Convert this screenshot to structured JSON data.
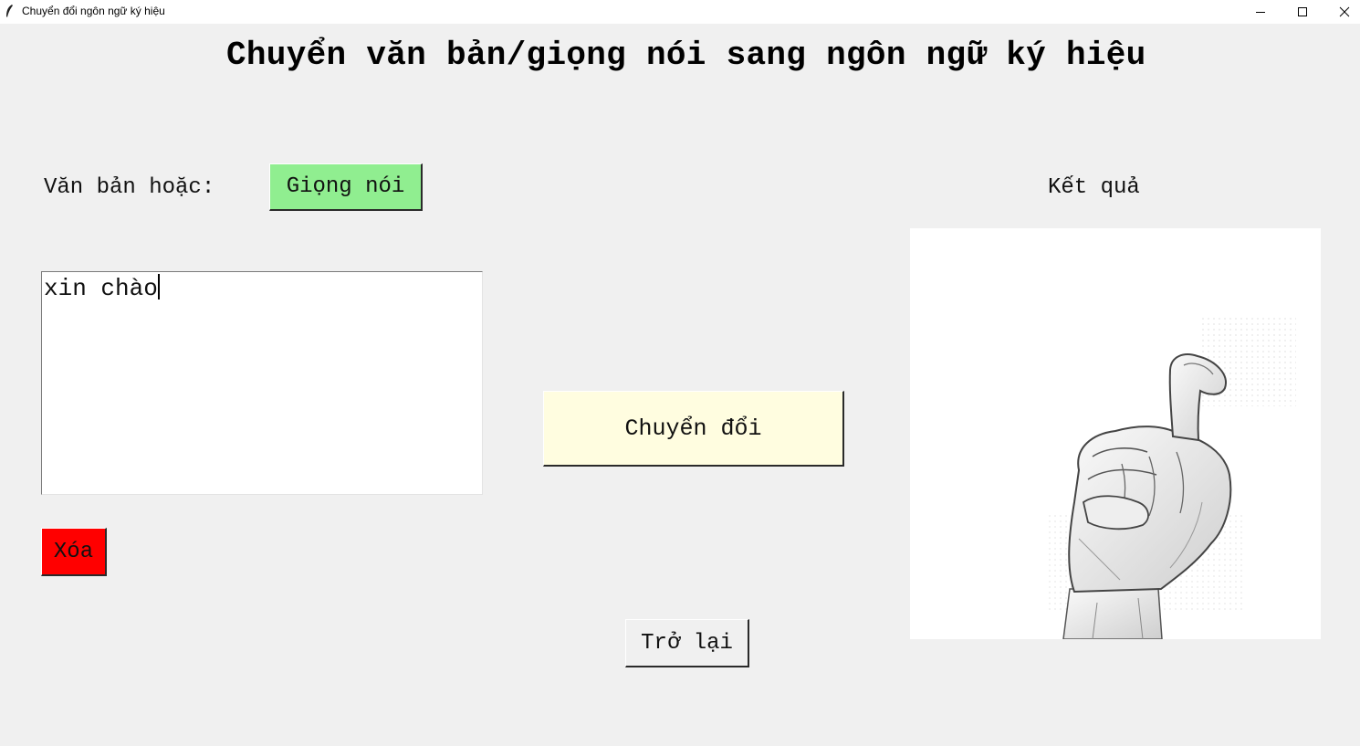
{
  "window": {
    "title": "Chuyển đổi ngôn ngữ ký hiệu",
    "icon": "feather-icon",
    "controls": [
      "minimize-icon",
      "maximize-icon",
      "close-icon"
    ]
  },
  "header": {
    "title": "Chuyển văn bản/giọng nói sang ngôn ngữ ký hiệu"
  },
  "input": {
    "label": "Văn bản hoặc:",
    "voice_button": "Giọng nói",
    "text_value": "xin chào",
    "clear_button": "Xóa"
  },
  "actions": {
    "convert_button": "Chuyển đổi",
    "back_button": "Trở lại"
  },
  "result": {
    "label": "Kết quả",
    "image": "hand-sign-illustration"
  },
  "colors": {
    "background": "#f0f0f0",
    "voice_button": "#90ee90",
    "convert_button": "#fffde0",
    "clear_button": "#ff0000"
  }
}
